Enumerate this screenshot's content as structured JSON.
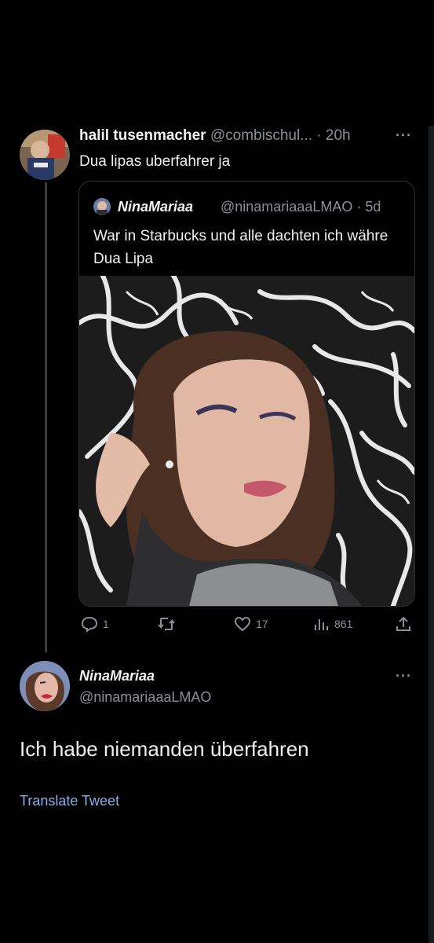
{
  "tweet1": {
    "name": "halil tusenmacher",
    "handle": "@combischul...",
    "time": "· 20h",
    "more": "···",
    "text": "Dua lipas uberfahrer ja"
  },
  "quote": {
    "name": "NinaMariaa",
    "handle": "@ninamariaaaLMAO · 5d",
    "text": "War in Starbucks und alle dachten ich währe Dua Lipa",
    "image": "selfie-photo"
  },
  "actions": {
    "reply_count": "1",
    "retweet_count": "",
    "like_count": "17",
    "views_count": "861"
  },
  "reply": {
    "name": "NinaMariaa",
    "handle": "@ninamariaaaLMAO",
    "more": "···",
    "text": "Ich habe niemanden überfahren",
    "translate": "Translate Tweet"
  },
  "colors": {
    "background": "#000000",
    "text": "#e7e9ea",
    "secondary": "#8b9094",
    "link": "#8aaee8",
    "border": "#2f3336"
  },
  "icons": [
    "reply-icon",
    "retweet-icon",
    "like-icon",
    "views-icon",
    "share-icon",
    "more-icon"
  ]
}
